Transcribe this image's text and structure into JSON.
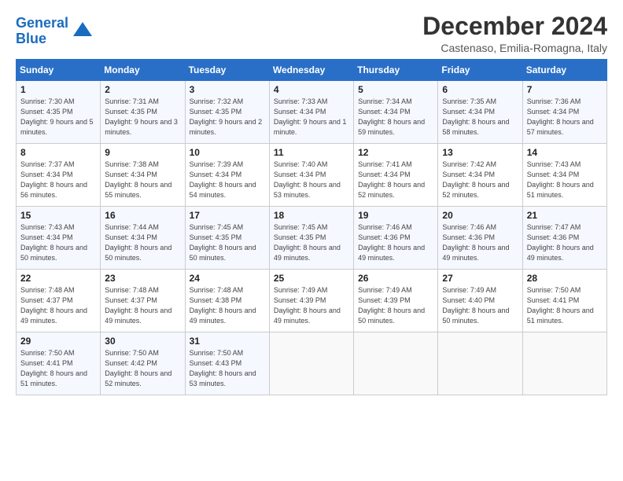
{
  "header": {
    "logo_line1": "General",
    "logo_line2": "Blue",
    "title": "December 2024",
    "subtitle": "Castenaso, Emilia-Romagna, Italy"
  },
  "weekdays": [
    "Sunday",
    "Monday",
    "Tuesday",
    "Wednesday",
    "Thursday",
    "Friday",
    "Saturday"
  ],
  "weeks": [
    [
      {
        "day": "1",
        "sunrise": "7:30 AM",
        "sunset": "4:35 PM",
        "daylight": "9 hours and 5 minutes."
      },
      {
        "day": "2",
        "sunrise": "7:31 AM",
        "sunset": "4:35 PM",
        "daylight": "9 hours and 3 minutes."
      },
      {
        "day": "3",
        "sunrise": "7:32 AM",
        "sunset": "4:35 PM",
        "daylight": "9 hours and 2 minutes."
      },
      {
        "day": "4",
        "sunrise": "7:33 AM",
        "sunset": "4:34 PM",
        "daylight": "9 hours and 1 minute."
      },
      {
        "day": "5",
        "sunrise": "7:34 AM",
        "sunset": "4:34 PM",
        "daylight": "8 hours and 59 minutes."
      },
      {
        "day": "6",
        "sunrise": "7:35 AM",
        "sunset": "4:34 PM",
        "daylight": "8 hours and 58 minutes."
      },
      {
        "day": "7",
        "sunrise": "7:36 AM",
        "sunset": "4:34 PM",
        "daylight": "8 hours and 57 minutes."
      }
    ],
    [
      {
        "day": "8",
        "sunrise": "7:37 AM",
        "sunset": "4:34 PM",
        "daylight": "8 hours and 56 minutes."
      },
      {
        "day": "9",
        "sunrise": "7:38 AM",
        "sunset": "4:34 PM",
        "daylight": "8 hours and 55 minutes."
      },
      {
        "day": "10",
        "sunrise": "7:39 AM",
        "sunset": "4:34 PM",
        "daylight": "8 hours and 54 minutes."
      },
      {
        "day": "11",
        "sunrise": "7:40 AM",
        "sunset": "4:34 PM",
        "daylight": "8 hours and 53 minutes."
      },
      {
        "day": "12",
        "sunrise": "7:41 AM",
        "sunset": "4:34 PM",
        "daylight": "8 hours and 52 minutes."
      },
      {
        "day": "13",
        "sunrise": "7:42 AM",
        "sunset": "4:34 PM",
        "daylight": "8 hours and 52 minutes."
      },
      {
        "day": "14",
        "sunrise": "7:43 AM",
        "sunset": "4:34 PM",
        "daylight": "8 hours and 51 minutes."
      }
    ],
    [
      {
        "day": "15",
        "sunrise": "7:43 AM",
        "sunset": "4:34 PM",
        "daylight": "8 hours and 50 minutes."
      },
      {
        "day": "16",
        "sunrise": "7:44 AM",
        "sunset": "4:34 PM",
        "daylight": "8 hours and 50 minutes."
      },
      {
        "day": "17",
        "sunrise": "7:45 AM",
        "sunset": "4:35 PM",
        "daylight": "8 hours and 50 minutes."
      },
      {
        "day": "18",
        "sunrise": "7:45 AM",
        "sunset": "4:35 PM",
        "daylight": "8 hours and 49 minutes."
      },
      {
        "day": "19",
        "sunrise": "7:46 AM",
        "sunset": "4:36 PM",
        "daylight": "8 hours and 49 minutes."
      },
      {
        "day": "20",
        "sunrise": "7:46 AM",
        "sunset": "4:36 PM",
        "daylight": "8 hours and 49 minutes."
      },
      {
        "day": "21",
        "sunrise": "7:47 AM",
        "sunset": "4:36 PM",
        "daylight": "8 hours and 49 minutes."
      }
    ],
    [
      {
        "day": "22",
        "sunrise": "7:48 AM",
        "sunset": "4:37 PM",
        "daylight": "8 hours and 49 minutes."
      },
      {
        "day": "23",
        "sunrise": "7:48 AM",
        "sunset": "4:37 PM",
        "daylight": "8 hours and 49 minutes."
      },
      {
        "day": "24",
        "sunrise": "7:48 AM",
        "sunset": "4:38 PM",
        "daylight": "8 hours and 49 minutes."
      },
      {
        "day": "25",
        "sunrise": "7:49 AM",
        "sunset": "4:39 PM",
        "daylight": "8 hours and 49 minutes."
      },
      {
        "day": "26",
        "sunrise": "7:49 AM",
        "sunset": "4:39 PM",
        "daylight": "8 hours and 50 minutes."
      },
      {
        "day": "27",
        "sunrise": "7:49 AM",
        "sunset": "4:40 PM",
        "daylight": "8 hours and 50 minutes."
      },
      {
        "day": "28",
        "sunrise": "7:50 AM",
        "sunset": "4:41 PM",
        "daylight": "8 hours and 51 minutes."
      }
    ],
    [
      {
        "day": "29",
        "sunrise": "7:50 AM",
        "sunset": "4:41 PM",
        "daylight": "8 hours and 51 minutes."
      },
      {
        "day": "30",
        "sunrise": "7:50 AM",
        "sunset": "4:42 PM",
        "daylight": "8 hours and 52 minutes."
      },
      {
        "day": "31",
        "sunrise": "7:50 AM",
        "sunset": "4:43 PM",
        "daylight": "8 hours and 53 minutes."
      },
      null,
      null,
      null,
      null
    ]
  ]
}
